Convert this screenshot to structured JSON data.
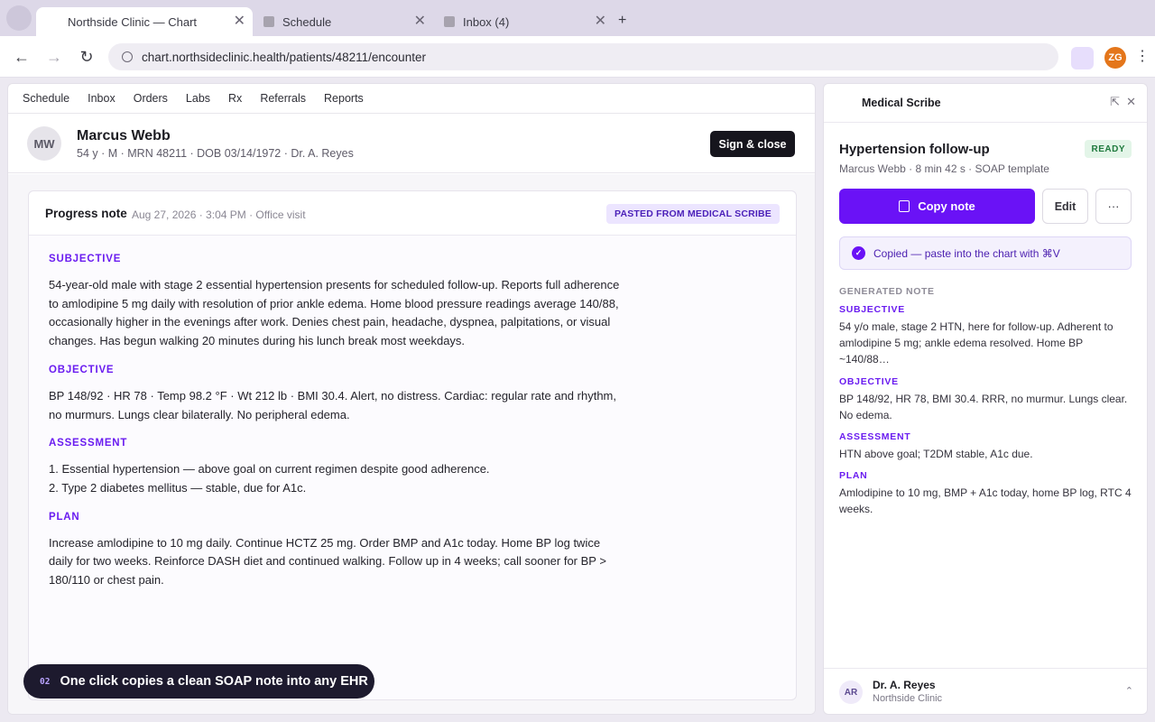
{
  "browser": {
    "tabs": [
      {
        "title": "Northside Clinic — Chart",
        "active": true
      },
      {
        "title": "Schedule",
        "active": false
      },
      {
        "title": "Inbox (4)",
        "active": false
      }
    ],
    "new_tab": "+",
    "url": "chart.northsideclinic.health/patients/48211/encounter",
    "profile_initials": "ZG",
    "profile_color": "#e4761b",
    "menu_icon": "⋮"
  },
  "ehr": {
    "nav": [
      "Schedule",
      "Inbox",
      "Orders",
      "Labs",
      "Rx",
      "Referrals",
      "Reports"
    ],
    "patient": {
      "initials": "MW",
      "name": "Marcus Webb",
      "meta": "54 y · M · MRN 48211 · DOB 03/14/1972 · Dr. A. Reyes"
    },
    "sign_close_label": "Sign & close",
    "note": {
      "title": "Progress note",
      "date": "Aug 27, 2026 · 3:04 PM · Office visit",
      "badge": "PASTED FROM MEDICAL SCRIBE",
      "sections": [
        {
          "heading": "SUBJECTIVE",
          "text": "54-year-old male with stage 2 essential hypertension presents for scheduled follow-up. Reports full adherence to amlodipine 5 mg daily with resolution of prior ankle edema. Home blood pressure readings average 140/88, occasionally higher in the evenings after work. Denies chest pain, headache, dyspnea, palpitations, or visual changes. Has begun walking 20 minutes during his lunch break most weekdays."
        },
        {
          "heading": "OBJECTIVE",
          "text": "BP 148/92 · HR 78 · Temp 98.2 °F · Wt 212 lb · BMI 30.4. Alert, no distress. Cardiac: regular rate and rhythm, no murmurs. Lungs clear bilaterally. No peripheral edema."
        },
        {
          "heading": "ASSESSMENT",
          "lines": [
            "1. Essential hypertension — above goal on current regimen despite good adherence.",
            "2. Type 2 diabetes mellitus — stable, due for A1c."
          ]
        },
        {
          "heading": "PLAN",
          "text": "Increase amlodipine to 10 mg daily. Continue HCTZ 25 mg. Order BMP and A1c today. Home BP log twice daily for two weeks. Reinforce DASH diet and continued walking. Follow up in 4 weeks; call sooner for BP > 180/110 or chest pain."
        }
      ]
    }
  },
  "toast": {
    "step": "02",
    "text": "One click copies a clean SOAP note into any EHR"
  },
  "scribe": {
    "title": "Medical Scribe",
    "encounter_title": "Hypertension follow-up",
    "status": "READY",
    "meta": "Marcus Webb · 8 min 42 s · SOAP template",
    "copy_label": "Copy note",
    "edit_label": "Edit",
    "more_label": "···",
    "copied_message": "Copied — paste into the chart with ⌘V",
    "generated_label": "GENERATED NOTE",
    "generated": [
      {
        "heading": "SUBJECTIVE",
        "text": "54 y/o male, stage 2 HTN, here for follow-up. Adherent to amlodipine 5 mg; ankle edema resolved. Home BP ~140/88…"
      },
      {
        "heading": "OBJECTIVE",
        "text": "BP 148/92, HR 78, BMI 30.4. RRR, no murmur. Lungs clear. No edema."
      },
      {
        "heading": "ASSESSMENT",
        "text": "HTN above goal; T2DM stable, A1c due."
      },
      {
        "heading": "PLAN",
        "text": "Amlodipine to 10 mg, BMP + A1c today, home BP log, RTC 4 weeks."
      }
    ],
    "footer": {
      "initials": "AR",
      "name": "Dr. A. Reyes",
      "org": "Northside Clinic"
    }
  },
  "colors": {
    "accent": "#6a12f6",
    "ready_green": "#1f7a3d"
  }
}
